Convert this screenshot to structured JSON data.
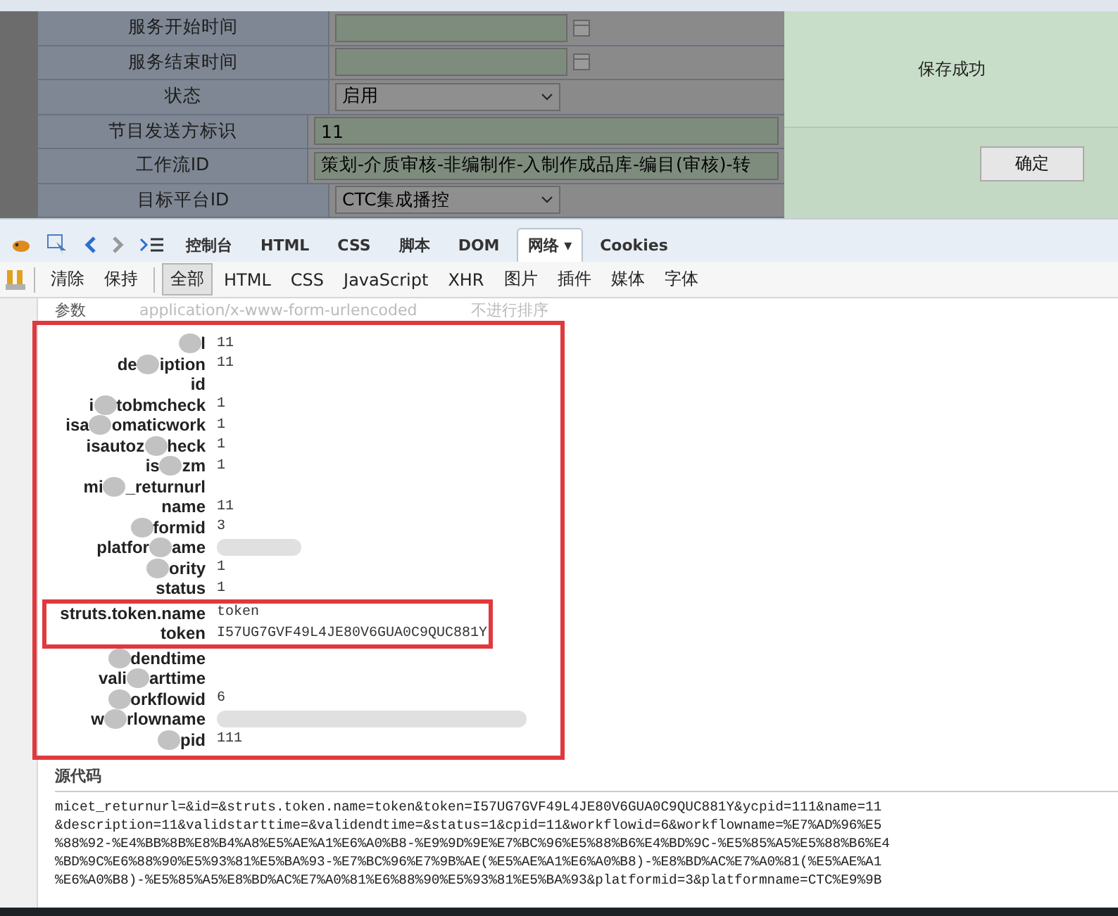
{
  "form": {
    "rows": [
      {
        "label": "服务开始时间",
        "kind": "date",
        "value": ""
      },
      {
        "label": "服务结束时间",
        "kind": "date",
        "value": ""
      },
      {
        "label": "状态",
        "kind": "select",
        "value": "启用"
      },
      {
        "label": "节目发送方标识",
        "kind": "text",
        "value": "11"
      },
      {
        "label": "工作流ID",
        "kind": "text",
        "value": "策划-介质审核-非编制作-入制作成品库-编目(审核)-转"
      },
      {
        "label": "目标平台ID",
        "kind": "select",
        "value": "CTC集成播控"
      }
    ]
  },
  "dialog": {
    "message": "保存成功",
    "button": "确定"
  },
  "devtools": {
    "tabs": [
      {
        "label": "控制台",
        "selected": false
      },
      {
        "label": "HTML",
        "selected": false
      },
      {
        "label": "CSS",
        "selected": false
      },
      {
        "label": "脚本",
        "selected": false
      },
      {
        "label": "DOM",
        "selected": false
      },
      {
        "label": "网络 ▾",
        "selected": true
      },
      {
        "label": "Cookies",
        "selected": false
      }
    ],
    "actions": [
      "清除",
      "保持"
    ],
    "filters": [
      {
        "label": "全部",
        "selected": true
      },
      {
        "label": "HTML",
        "selected": false
      },
      {
        "label": "CSS",
        "selected": false
      },
      {
        "label": "JavaScript",
        "selected": false
      },
      {
        "label": "XHR",
        "selected": false
      },
      {
        "label": "图片",
        "selected": false
      },
      {
        "label": "插件",
        "selected": false
      },
      {
        "label": "媒体",
        "selected": false
      },
      {
        "label": "字体",
        "selected": false
      }
    ]
  },
  "params": {
    "title": "参数",
    "content_type": "application/x-www-form-urlencoded",
    "sort": "不进行排序",
    "rows": [
      {
        "label": [
          {
            "kind": "smudge"
          },
          {
            "kind": "text",
            "text": "l"
          }
        ],
        "value": "11",
        "highlighted": false
      },
      {
        "label": [
          {
            "kind": "text",
            "text": "de"
          },
          {
            "kind": "smudge"
          },
          {
            "kind": "text",
            "text": "iption"
          }
        ],
        "value": "11",
        "highlighted": false
      },
      {
        "label": [
          {
            "kind": "text",
            "text": "id"
          }
        ],
        "highlighted": false
      },
      {
        "label": [
          {
            "kind": "text",
            "text": "i"
          },
          {
            "kind": "smudge"
          },
          {
            "kind": "text",
            "text": "tobmcheck"
          }
        ],
        "value": "1",
        "highlighted": false
      },
      {
        "label": [
          {
            "kind": "text",
            "text": "isa"
          },
          {
            "kind": "smudge"
          },
          {
            "kind": "text",
            "text": "omaticwork"
          }
        ],
        "value": "1",
        "highlighted": false
      },
      {
        "label": [
          {
            "kind": "text",
            "text": "isautoz"
          },
          {
            "kind": "smudge"
          },
          {
            "kind": "text",
            "text": "heck"
          }
        ],
        "value": "1",
        "highlighted": false
      },
      {
        "label": [
          {
            "kind": "text",
            "text": "is"
          },
          {
            "kind": "smudge"
          },
          {
            "kind": "text",
            "text": "zm"
          }
        ],
        "value": "1",
        "highlighted": false
      },
      {
        "label": [
          {
            "kind": "text",
            "text": "mi"
          },
          {
            "kind": "smudge"
          },
          {
            "kind": "text",
            "text": "_returnurl"
          }
        ],
        "highlighted": false
      },
      {
        "label": [
          {
            "kind": "text",
            "text": "name"
          }
        ],
        "value": "11",
        "highlighted": false
      },
      {
        "label": [
          {
            "kind": "smudge"
          },
          {
            "kind": "text",
            "text": "formid"
          }
        ],
        "value": "3",
        "highlighted": false
      },
      {
        "label": [
          {
            "kind": "text",
            "text": "platfor"
          },
          {
            "kind": "smudge"
          },
          {
            "kind": "text",
            "text": "ame"
          }
        ],
        "value_redacted": true,
        "highlighted": false
      },
      {
        "label": [
          {
            "kind": "smudge"
          },
          {
            "kind": "text",
            "text": "ority"
          }
        ],
        "value": "1",
        "highlighted": false
      },
      {
        "label": [
          {
            "kind": "text",
            "text": "status"
          }
        ],
        "value": "1",
        "highlighted": false
      },
      {
        "label": [
          {
            "kind": "text",
            "text": "struts.token.name"
          }
        ],
        "value": "token",
        "highlighted": true
      },
      {
        "label": [
          {
            "kind": "text",
            "text": "token"
          }
        ],
        "value": "I57UG7GVF49L4JE80V6GUA0C9QUC881Y",
        "highlighted": true
      },
      {
        "label": [
          {
            "kind": "smudge"
          },
          {
            "kind": "text",
            "text": "dendtime"
          }
        ],
        "highlighted": false
      },
      {
        "label": [
          {
            "kind": "text",
            "text": "vali"
          },
          {
            "kind": "smudge"
          },
          {
            "kind": "text",
            "text": "arttime"
          }
        ],
        "highlighted": false
      },
      {
        "label": [
          {
            "kind": "smudge"
          },
          {
            "kind": "text",
            "text": "orkflowid"
          }
        ],
        "value": "6",
        "highlighted": false
      },
      {
        "label": [
          {
            "kind": "text",
            "text": "w"
          },
          {
            "kind": "smudge"
          },
          {
            "kind": "text",
            "text": "rlowname"
          }
        ],
        "value_redacted": true,
        "highlighted": false
      },
      {
        "label": [
          {
            "kind": "smudge"
          },
          {
            "kind": "text",
            "text": "pid"
          }
        ],
        "value": "111",
        "highlighted": false
      }
    ]
  },
  "source": {
    "title": "源代码",
    "lines": [
      "micet_returnurl=&id=&struts.token.name=token&token=I57UG7GVF49L4JE80V6GUA0C9QUC881Y&ycpid=111&name=11",
      "&description=11&validstarttime=&validendtime=&status=1&cpid=11&workflowid=6&workflowname=%E7%AD%96%E5",
      "%88%92-%E4%BB%8B%E8%B4%A8%E5%AE%A1%E6%A0%B8-%E9%9D%9E%E7%BC%96%E5%88%B6%E4%BD%9C-%E5%85%A5%E5%88%B6%E4",
      "%BD%9C%E6%88%90%E5%93%81%E5%BA%93-%E7%BC%96%E7%9B%AE(%E5%AE%A1%E6%A0%B8)-%E8%BD%AC%E7%A0%81(%E5%AE%A1",
      "%E6%A0%B8)-%E5%85%A5%E8%BD%AC%E7%A0%81%E6%88%90%E5%93%81%E5%BA%93&platformid=3&platformname=CTC%E9%9B"
    ]
  }
}
